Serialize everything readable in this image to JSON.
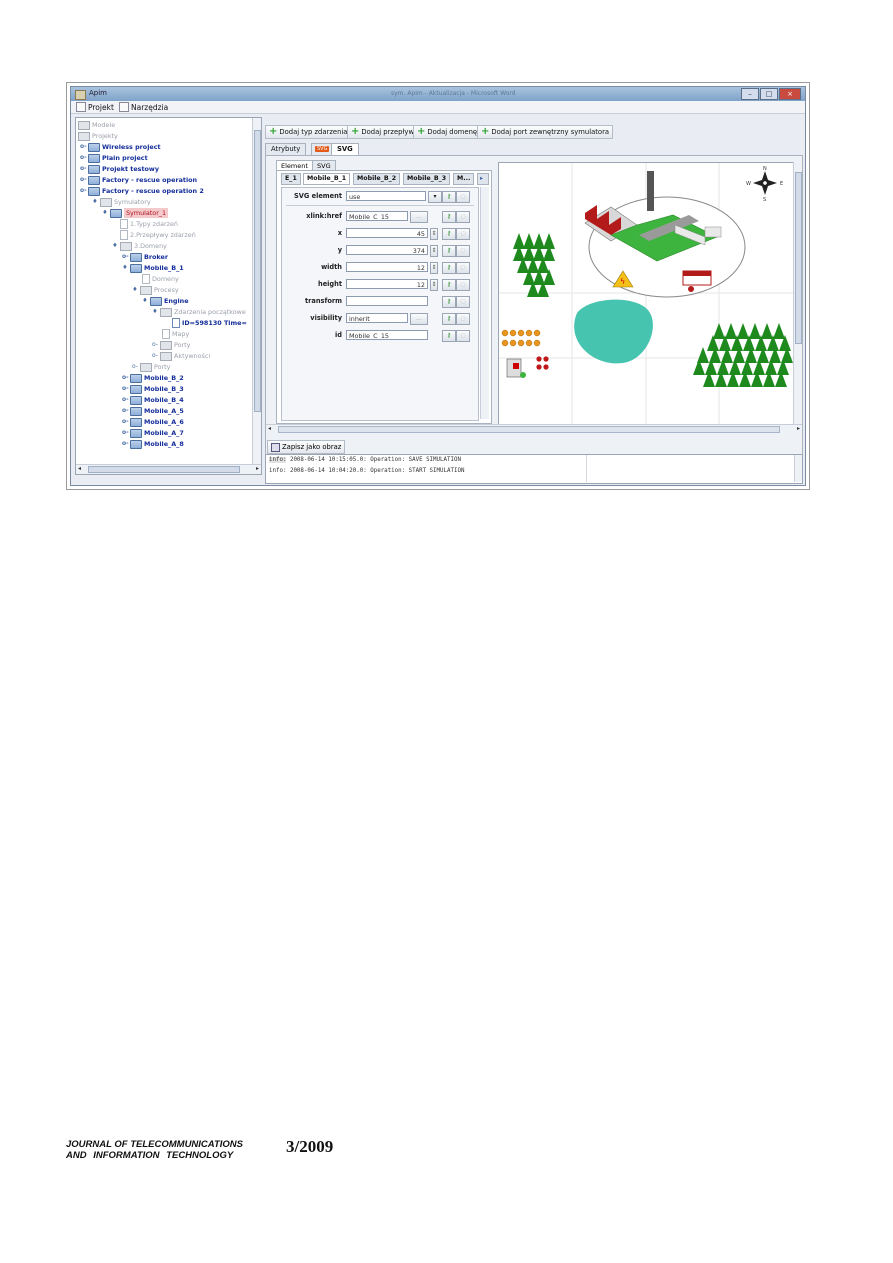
{
  "window": {
    "title": "Apim",
    "ghost_title": "sym. Apim - Aktualizacja - Microsoft Word"
  },
  "menu": {
    "items": [
      {
        "label": "Projekt"
      },
      {
        "label": "Narzędzia"
      }
    ]
  },
  "tree": {
    "nodes": [
      "Modele",
      "Projekty",
      "Wireless project",
      "Plain project",
      "Projekt testowy",
      "Factory - rescue operation",
      "Factory - rescue operation 2",
      "Symulatory",
      "Symulator_1",
      "1.Typy zdarzeń",
      "2.Przepływy zdarzeń",
      "3.Domeny",
      "Broker",
      "Mobile_B_1",
      "Domeny",
      "Procesy",
      "Engine",
      "Zdarzenia początkowe",
      "ID=598130 Time=",
      "Mapy",
      "Porty",
      "Aktywności",
      "Porty",
      "Mobile_B_2",
      "Mobile_B_3",
      "Mobile_B_4",
      "Mobile_A_5",
      "Mobile_A_6",
      "Mobile_A_7",
      "Mobile_A_8"
    ]
  },
  "toolbar": {
    "buttons": [
      "Dodaj typ zdarzenia",
      "Dodaj przepływ",
      "Dodaj domenę",
      "Dodaj port zewnętrzny symulatora"
    ]
  },
  "tabs": {
    "atrybuty": "Atrybuty",
    "svg_badge": "SVG",
    "svg": "SVG"
  },
  "subtabs": {
    "element": "Element",
    "svg": "SVG"
  },
  "element_tabs": [
    "E_1",
    "Mobile_B_1",
    "Mobile_B_2",
    "Mobile_B_3",
    "M..."
  ],
  "attributes": {
    "svg_element": {
      "label": "SVG element",
      "value": "use"
    },
    "xlink": {
      "label": "xlink:href",
      "value": "Mobile_C_15"
    },
    "x": {
      "label": "x",
      "value": "45"
    },
    "y": {
      "label": "y",
      "value": "374"
    },
    "width": {
      "label": "width",
      "value": "12"
    },
    "height": {
      "label": "height",
      "value": "12"
    },
    "transform": {
      "label": "transform",
      "value": ""
    },
    "visibility": {
      "label": "visibility",
      "value": "inherit"
    },
    "id": {
      "label": "id",
      "value": "Mobile_C_15"
    }
  },
  "compass": {
    "n": "N",
    "s": "S",
    "e": "E",
    "w": "W"
  },
  "save_button": "Zapisz jako obraz",
  "log": [
    {
      "level": "info:",
      "text": "2008-06-14 10:15:05.0: Operation: SAVE SIMULATION"
    },
    {
      "level": "info:",
      "text": "2008-06-14 10:04:20.0: Operation: START SIMULATION"
    }
  ],
  "footer": {
    "journal_line1": "JOURNAL OF TELECOMMUNICATIONS",
    "journal_line2": "AND INFORMATION TECHNOLOGY",
    "issue": "3/2009"
  },
  "colors": {
    "accent_green": "#2ea12e",
    "selection_red": "#b0111b",
    "tree_blue": "#132d9a"
  }
}
